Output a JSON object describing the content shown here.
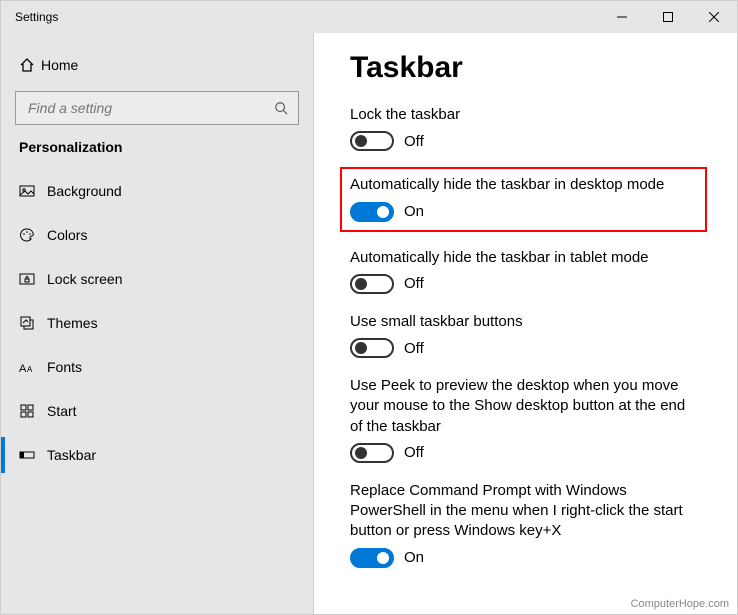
{
  "window_title": "Settings",
  "controls": {
    "min": "–",
    "max": "☐",
    "close": "✕"
  },
  "home_label": "Home",
  "search_placeholder": "Find a setting",
  "category": "Personalization",
  "nav": [
    {
      "label": "Background"
    },
    {
      "label": "Colors"
    },
    {
      "label": "Lock screen"
    },
    {
      "label": "Themes"
    },
    {
      "label": "Fonts"
    },
    {
      "label": "Start"
    },
    {
      "label": "Taskbar",
      "selected": true
    }
  ],
  "page_title": "Taskbar",
  "settings": [
    {
      "label": "Lock the taskbar",
      "state": "Off",
      "on": false,
      "highlight": false
    },
    {
      "label": "Automatically hide the taskbar in desktop mode",
      "state": "On",
      "on": true,
      "highlight": true
    },
    {
      "label": "Automatically hide the taskbar in tablet mode",
      "state": "Off",
      "on": false,
      "highlight": false
    },
    {
      "label": "Use small taskbar buttons",
      "state": "Off",
      "on": false,
      "highlight": false
    },
    {
      "label": "Use Peek to preview the desktop when you move your mouse to the Show desktop button at the end of the taskbar",
      "state": "Off",
      "on": false,
      "highlight": false
    },
    {
      "label": "Replace Command Prompt with Windows PowerShell in the menu when I right-click the start button or press Windows key+X",
      "state": "On",
      "on": true,
      "highlight": false
    }
  ],
  "watermark": "ComputerHope.com"
}
